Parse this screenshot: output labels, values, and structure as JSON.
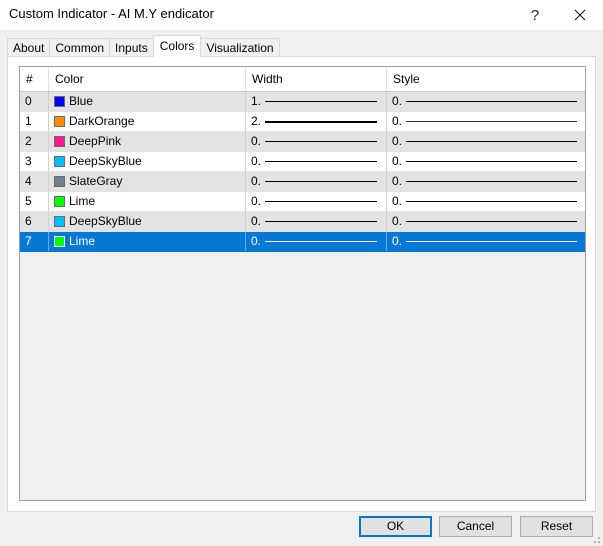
{
  "window": {
    "title": "Custom Indicator - AI M.Y endicator",
    "help_label": "?"
  },
  "tabs": [
    {
      "label": "About",
      "active": false
    },
    {
      "label": "Common",
      "active": false
    },
    {
      "label": "Inputs",
      "active": false
    },
    {
      "label": "Colors",
      "active": true
    },
    {
      "label": "Visualization",
      "active": false
    }
  ],
  "grid": {
    "headers": {
      "num": "#",
      "color": "Color",
      "width": "Width",
      "style": "Style"
    },
    "rows": [
      {
        "num": "0",
        "color_name": "Blue",
        "color_hex": "#0000ff",
        "width": "1.",
        "width_thick": false,
        "style": "0.",
        "selected": false
      },
      {
        "num": "1",
        "color_name": "DarkOrange",
        "color_hex": "#ff8c00",
        "width": "2.",
        "width_thick": true,
        "style": "0.",
        "selected": false
      },
      {
        "num": "2",
        "color_name": "DeepPink",
        "color_hex": "#ff1493",
        "width": "0.",
        "width_thick": false,
        "style": "0.",
        "selected": false
      },
      {
        "num": "3",
        "color_name": "DeepSkyBlue",
        "color_hex": "#00bfff",
        "width": "0.",
        "width_thick": false,
        "style": "0.",
        "selected": false
      },
      {
        "num": "4",
        "color_name": "SlateGray",
        "color_hex": "#708090",
        "width": "0.",
        "width_thick": false,
        "style": "0.",
        "selected": false
      },
      {
        "num": "5",
        "color_name": "Lime",
        "color_hex": "#00ff00",
        "width": "0.",
        "width_thick": false,
        "style": "0.",
        "selected": false
      },
      {
        "num": "6",
        "color_name": "DeepSkyBlue",
        "color_hex": "#00bfff",
        "width": "0.",
        "width_thick": false,
        "style": "0.",
        "selected": false
      },
      {
        "num": "7",
        "color_name": "Lime",
        "color_hex": "#00ff00",
        "width": "0.",
        "width_thick": false,
        "style": "0.",
        "selected": true
      }
    ]
  },
  "buttons": {
    "ok": "OK",
    "cancel": "Cancel",
    "reset": "Reset"
  },
  "colors": {
    "selection": "#0878d7",
    "alt_row": "#e3e3e3",
    "default_button_border": "#0078d7"
  }
}
